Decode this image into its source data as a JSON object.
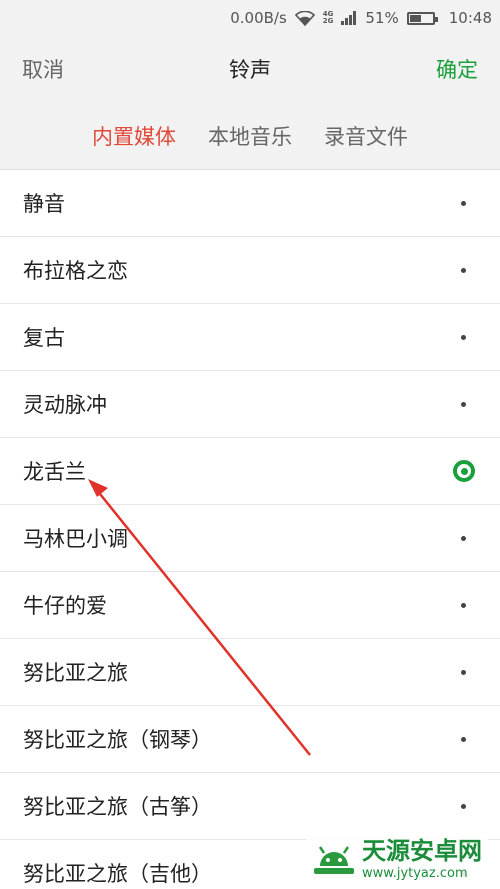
{
  "status_bar": {
    "speed": "0.00B/s",
    "network": [
      "4G",
      "2G"
    ],
    "battery_percent": "51%",
    "battery_level": 0.51,
    "time": "10:48"
  },
  "header": {
    "cancel_label": "取消",
    "title": "铃声",
    "confirm_label": "确定"
  },
  "tabs": [
    {
      "label": "内置媒体",
      "active": true
    },
    {
      "label": "本地音乐",
      "active": false
    },
    {
      "label": "录音文件",
      "active": false
    }
  ],
  "ringtones": [
    {
      "label": "静音",
      "selected": false
    },
    {
      "label": "布拉格之恋",
      "selected": false
    },
    {
      "label": "复古",
      "selected": false
    },
    {
      "label": "灵动脉冲",
      "selected": false
    },
    {
      "label": "龙舌兰",
      "selected": true
    },
    {
      "label": "马林巴小调",
      "selected": false
    },
    {
      "label": "牛仔的爱",
      "selected": false
    },
    {
      "label": "努比亚之旅",
      "selected": false
    },
    {
      "label": "努比亚之旅（钢琴）",
      "selected": false
    },
    {
      "label": "努比亚之旅（古筝）",
      "selected": false
    },
    {
      "label": "努比亚之旅（吉他）",
      "selected": false
    }
  ],
  "watermark": {
    "title": "天源安卓网",
    "url": "www.jytyaz.com"
  },
  "colors": {
    "accent_green": "#1aa03a",
    "active_tab_red": "#e14a3b",
    "annotation_arrow": "#e0322a"
  }
}
